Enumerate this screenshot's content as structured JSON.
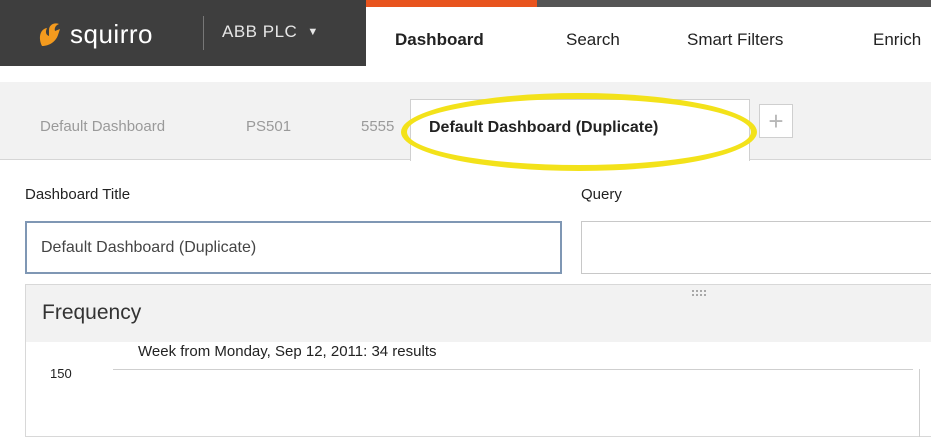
{
  "header": {
    "logo_text": "squirro",
    "project_label": "ABB PLC",
    "nav": [
      "Dashboard",
      "Search",
      "Smart Filters",
      "Enrich"
    ],
    "active_nav_index": 0,
    "accent_color": "#e8541e",
    "brand_bg": "#3e3e3e"
  },
  "dashboard_tabs": {
    "items": [
      "Default Dashboard",
      "PS501",
      "5555"
    ],
    "active": "Default Dashboard (Duplicate)",
    "add_icon": "plus-icon",
    "highlight_color": "#f3e21a"
  },
  "form": {
    "title_label": "Dashboard Title",
    "title_value": "Default Dashboard (Duplicate)",
    "query_label": "Query",
    "query_value": ""
  },
  "widget": {
    "title": "Frequency",
    "hover_note": "Week from Monday, Sep 12, 2011: 34 results",
    "y_tick": "150"
  }
}
